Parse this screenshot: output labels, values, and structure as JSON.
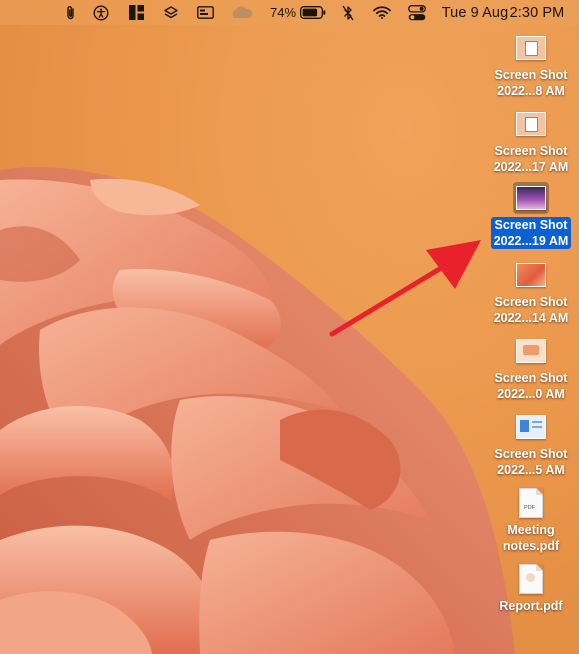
{
  "menubar": {
    "battery_percent": "74%",
    "date": "Tue 9 Aug",
    "time": "2:30 PM",
    "icons": [
      "paperclip-icon",
      "accessibility-icon",
      "window-layout-icon",
      "layers-icon",
      "screen-share-icon",
      "cloud-icon",
      "battery-icon",
      "bluetooth-off-icon",
      "wifi-icon",
      "control-center-icon"
    ]
  },
  "desktop": {
    "items": [
      {
        "line1": "Screen Shot",
        "line2": "2022...8 AM",
        "kind": "screenshot",
        "selected": false
      },
      {
        "line1": "Screen Shot",
        "line2": "2022...17 AM",
        "kind": "screenshot",
        "selected": false
      },
      {
        "line1": "Screen Shot",
        "line2": "2022...19 AM",
        "kind": "screenshot",
        "selected": true
      },
      {
        "line1": "Screen Shot",
        "line2": "2022...14 AM",
        "kind": "screenshot",
        "selected": false
      },
      {
        "line1": "Screen Shot",
        "line2": "2022...0 AM",
        "kind": "screenshot",
        "selected": false
      },
      {
        "line1": "Screen Shot",
        "line2": "2022...5 AM",
        "kind": "screenshot",
        "selected": false
      },
      {
        "line1": "Meeting",
        "line2": "notes.pdf",
        "kind": "pdf",
        "tag": "PDF",
        "selected": false
      },
      {
        "line1": "Report.pdf",
        "line2": "",
        "kind": "pdf",
        "tag": "",
        "selected": false
      }
    ]
  },
  "annotation": {
    "arrow_color": "#e8212b"
  }
}
